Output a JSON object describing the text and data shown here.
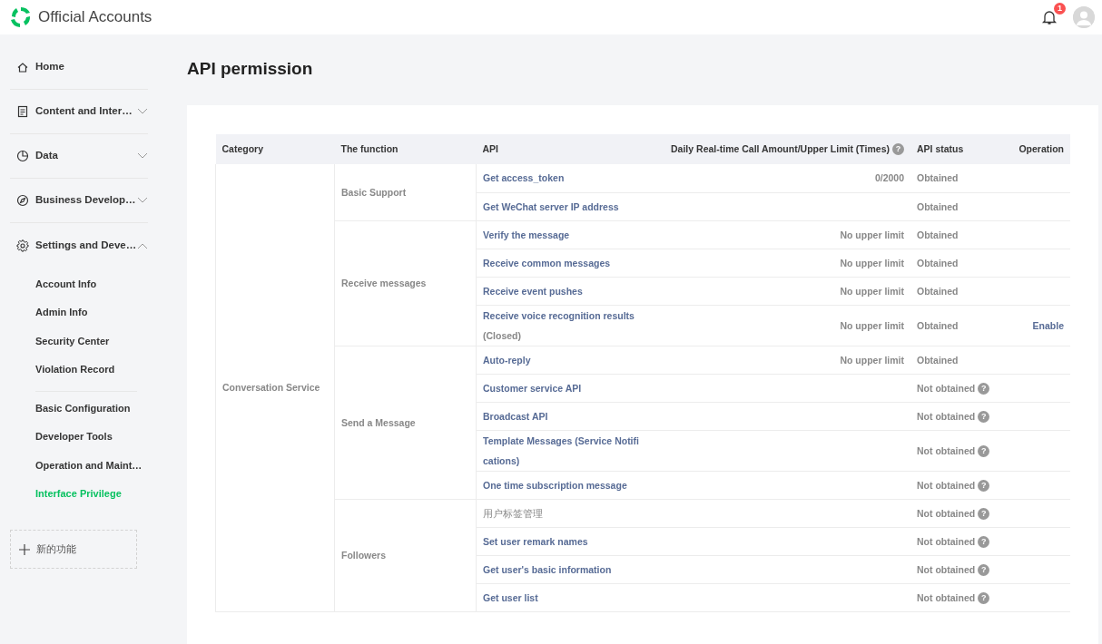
{
  "header": {
    "title": "Official Accounts",
    "notification_count": "1"
  },
  "sidebar": {
    "items": [
      {
        "label": "Home"
      },
      {
        "label": "Content and Inter…",
        "expanded": false
      },
      {
        "label": "Data",
        "expanded": false
      },
      {
        "label": "Business Develop…",
        "expanded": false
      },
      {
        "label": "Settings and Deve…",
        "expanded": true,
        "children_groups": [
          [
            {
              "label": "Account Info",
              "selected": false
            },
            {
              "label": "Admin Info",
              "selected": false
            },
            {
              "label": "Security Center",
              "selected": false
            },
            {
              "label": "Violation Record",
              "selected": false
            }
          ],
          [
            {
              "label": "Basic Configuration",
              "selected": false
            },
            {
              "label": "Developer Tools",
              "selected": false
            },
            {
              "label": "Operation and Maint…",
              "selected": false
            },
            {
              "label": "Interface Privilege",
              "selected": true
            }
          ]
        ]
      }
    ],
    "new_feature": "新的功能"
  },
  "page_title": "API permission",
  "table": {
    "columns": [
      "Category",
      "The function",
      "API",
      "Daily Real-time Call Amount/Upper Limit (Times)",
      "API status",
      "Operation"
    ],
    "limit_help": "?",
    "categories": [
      {
        "name": "Conversation Service",
        "functions": [
          {
            "name": "Basic Support",
            "apis": [
              {
                "name": "Get access_token",
                "linked": true,
                "limit": "0/2000",
                "status": "Obtained"
              },
              {
                "name": "Get WeChat server IP address",
                "linked": true,
                "status": "Obtained"
              }
            ]
          },
          {
            "name": "Receive messages",
            "apis": [
              {
                "name": "Verify the message",
                "linked": true,
                "limit": "No upper limit",
                "status": "Obtained"
              },
              {
                "name": "Receive common messages",
                "linked": true,
                "limit": "No upper limit",
                "status": "Obtained"
              },
              {
                "name": "Receive event pushes",
                "linked": true,
                "limit": "No upper limit",
                "status": "Obtained"
              },
              {
                "name": "Receive voice recognition results",
                "note": "(Closed)",
                "linked": true,
                "limit": "No upper limit",
                "status": "Obtained",
                "operation": "Enable"
              }
            ]
          },
          {
            "name": "Send a Message",
            "apis": [
              {
                "name": "Auto-reply",
                "linked": true,
                "limit": "No upper limit",
                "status": "Obtained"
              },
              {
                "name": "Customer service API",
                "linked": true,
                "status": "Not obtained",
                "help": "?"
              },
              {
                "name": "Broadcast API",
                "linked": true,
                "status": "Not obtained",
                "help": "?"
              },
              {
                "name": "Template Messages (Service Notifications)",
                "linked": true,
                "status": "Not obtained",
                "help": "?"
              },
              {
                "name": "One time subscription message",
                "linked": true,
                "status": "Not obtained",
                "help": "?"
              }
            ]
          },
          {
            "name": "Followers",
            "apis": [
              {
                "name": "用户标签管理",
                "linked": false,
                "status": "Not obtained",
                "help": "?"
              },
              {
                "name": "Set user remark names",
                "linked": true,
                "status": "Not obtained",
                "help": "?"
              },
              {
                "name": "Get user's basic information",
                "linked": true,
                "status": "Not obtained",
                "help": "?"
              },
              {
                "name": "Get user list",
                "linked": true,
                "status": "Not obtained",
                "help": "?"
              }
            ]
          }
        ]
      }
    ]
  }
}
